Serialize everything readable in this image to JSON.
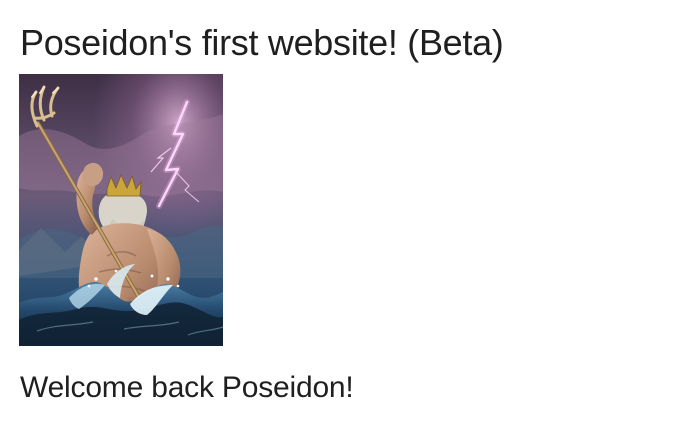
{
  "page": {
    "title": "Poseidon's first website! (Beta)",
    "welcome_message": "Welcome back Poseidon!"
  },
  "hero_image": {
    "subject": "Poseidon with trident, lightning and waves",
    "colors": {
      "sky_top": "#3e2f45",
      "sky_mid": "#6b5a78",
      "sky_bottom": "#2c4f72",
      "sea_dark": "#12283d",
      "sea_light": "#d9eef7",
      "skin": "#b98b6e",
      "beard": "#d8d6cf",
      "crown": "#c9a53c",
      "lightning": "#fff3ff",
      "trident": "#c8a66e"
    }
  }
}
